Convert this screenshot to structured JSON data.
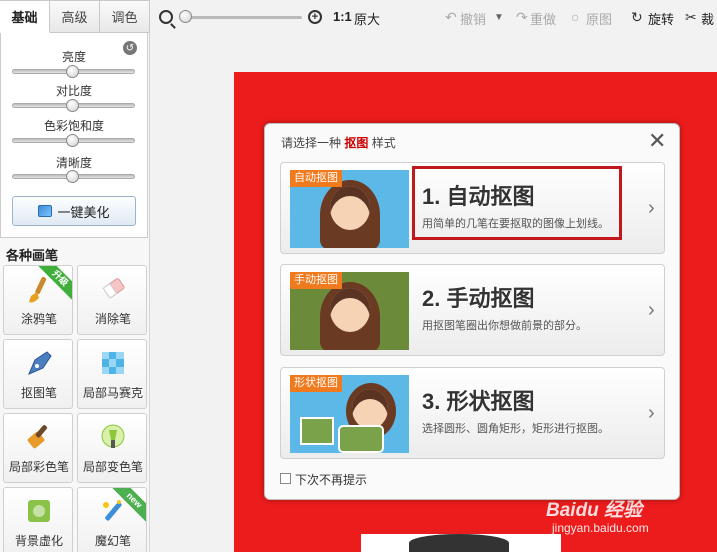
{
  "left_panel": {
    "tabs": [
      "基础",
      "高级",
      "调色"
    ],
    "sliders": [
      {
        "label": "亮度",
        "value": 0.5
      },
      {
        "label": "对比度",
        "value": 0.5
      },
      {
        "label": "色彩饱和度",
        "value": 0.5
      },
      {
        "label": "清晰度",
        "value": 0.5
      }
    ],
    "beautify_label": "一键美化",
    "brushes_title": "各种画笔",
    "tools": [
      {
        "label": "涂鸦笔",
        "badge": "升级",
        "icon": "paint-brush-icon"
      },
      {
        "label": "消除笔",
        "icon": "eraser-icon"
      },
      {
        "label": "抠图笔",
        "icon": "pen-nib-icon"
      },
      {
        "label": "局部马赛克",
        "icon": "mosaic-icon"
      },
      {
        "label": "局部彩色笔",
        "icon": "color-brush-icon"
      },
      {
        "label": "局部变色笔",
        "icon": "color-change-icon"
      },
      {
        "label": "背景虚化",
        "icon": "blur-icon"
      },
      {
        "label": "魔幻笔",
        "badge": "new",
        "icon": "magic-wand-icon"
      }
    ]
  },
  "toolbar": {
    "zoom_ratio": "1:1",
    "original_size": "原大",
    "undo": "撤销",
    "redo": "重做",
    "original": "原图",
    "rotate": "旋转",
    "crop": "裁"
  },
  "dialog": {
    "title_prefix": "请选择一种",
    "title_highlight": "抠图",
    "title_suffix": "样式",
    "options": [
      {
        "tag": "自动抠图",
        "title": "1. 自动抠图",
        "desc": "用简单的几笔在要抠取的图像上划线。"
      },
      {
        "tag": "手动抠图",
        "title": "2. 手动抠图",
        "desc": "用抠图笔圈出你想做前景的部分。"
      },
      {
        "tag": "形状抠图",
        "title": "3. 形状抠图",
        "desc": "选择圆形、圆角矩形，矩形进行抠图。"
      }
    ],
    "dont_show_again": "下次不再提示"
  },
  "watermark": {
    "brand": "Baidu 经验",
    "url": "jingyan.baidu.com"
  },
  "colors": {
    "canvas_red": "#ec1c1c",
    "highlight": "#c2171c",
    "tag_orange": "#f07a1e"
  }
}
